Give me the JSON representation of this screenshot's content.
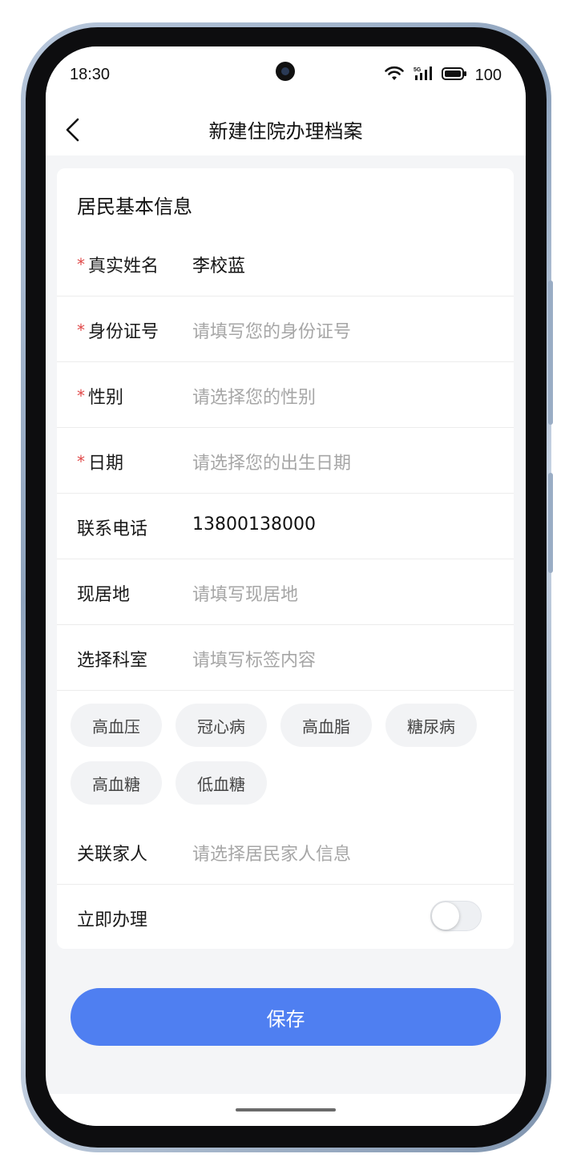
{
  "status_bar": {
    "time": "18:30",
    "battery": "100",
    "icons": [
      "wifi-icon",
      "cellular-5g-icon",
      "battery-icon"
    ]
  },
  "nav": {
    "title": "新建住院办理档案",
    "back_icon": "chevron-left-icon"
  },
  "section": {
    "title": "居民基本信息"
  },
  "fields": [
    {
      "label": "真实姓名",
      "required": "*",
      "value": "李校蓝",
      "placeholder": ""
    },
    {
      "label": "身份证号",
      "required": "*",
      "value": "",
      "placeholder": "请填写您的身份证号"
    },
    {
      "label": "性别",
      "required": "*",
      "value": "",
      "placeholder": "请选择您的性别"
    },
    {
      "label": "日期",
      "required": "*",
      "value": "",
      "placeholder": "请选择您的出生日期"
    },
    {
      "label": "联系电话",
      "value": "13800138000",
      "placeholder": ""
    },
    {
      "label": "现居地",
      "value": "",
      "placeholder": "请填写现居地"
    },
    {
      "label": "选择科室",
      "value": "",
      "placeholder": "请填写标签内容"
    }
  ],
  "tags": [
    "高血压",
    "冠心病",
    "高血脂",
    "糖尿病",
    "高血糖",
    "低血糖"
  ],
  "family": {
    "label": "关联家人",
    "placeholder": "请选择居民家人信息"
  },
  "immediate": {
    "label": "立即办理",
    "toggle_on": false
  },
  "save_button": {
    "label": "保存"
  },
  "colors": {
    "accent": "#4f7ff1",
    "required": "#e04848",
    "placeholder": "#a6a6a6",
    "background": "#f4f5f7"
  }
}
